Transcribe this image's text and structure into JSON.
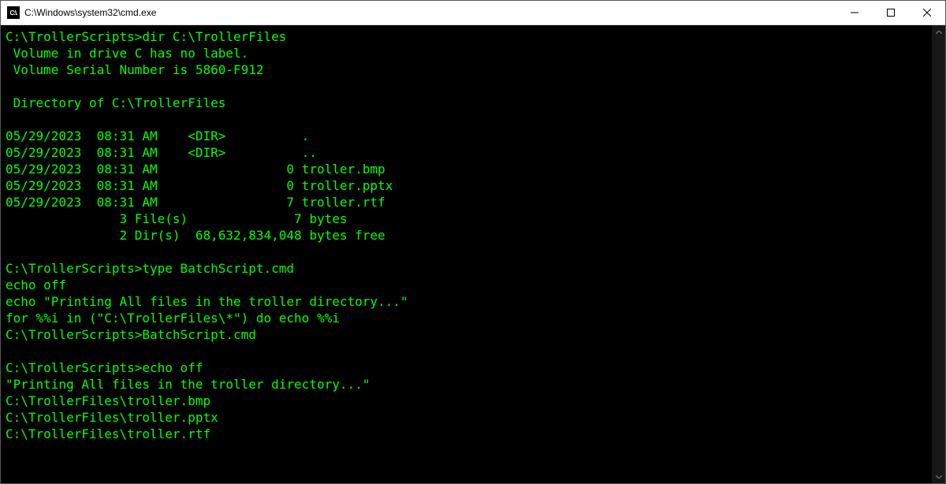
{
  "window": {
    "title": "C:\\Windows\\system32\\cmd.exe",
    "icon_text": "C:\\."
  },
  "terminal": {
    "lines": [
      "C:\\TrollerScripts>dir C:\\TrollerFiles",
      " Volume in drive C has no label.",
      " Volume Serial Number is 5860-F912",
      "",
      " Directory of C:\\TrollerFiles",
      "",
      "05/29/2023  08:31 AM    <DIR>          .",
      "05/29/2023  08:31 AM    <DIR>          ..",
      "05/29/2023  08:31 AM                 0 troller.bmp",
      "05/29/2023  08:31 AM                 0 troller.pptx",
      "05/29/2023  08:31 AM                 7 troller.rtf",
      "               3 File(s)              7 bytes",
      "               2 Dir(s)  68,632,834,048 bytes free",
      "",
      "C:\\TrollerScripts>type BatchScript.cmd",
      "echo off",
      "echo \"Printing All files in the troller directory...\"",
      "for %%i in (\"C:\\TrollerFiles\\*\") do echo %%i",
      "C:\\TrollerScripts>BatchScript.cmd",
      "",
      "C:\\TrollerScripts>echo off",
      "\"Printing All files in the troller directory...\"",
      "C:\\TrollerFiles\\troller.bmp",
      "C:\\TrollerFiles\\troller.pptx",
      "C:\\TrollerFiles\\troller.rtf"
    ]
  }
}
